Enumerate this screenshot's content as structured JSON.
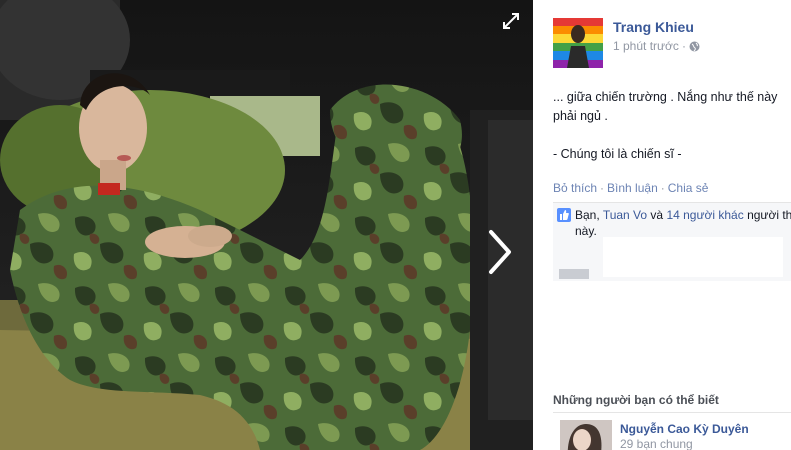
{
  "post": {
    "author": "Trang Khieu",
    "time": "1 phút trước",
    "separator": "·",
    "caption_line1": "... giữa chiến trường . Nắng như thế này",
    "caption_line2": "phải ngủ .",
    "caption_line3": "- Chúng tôi là chiến sĩ -"
  },
  "actions": {
    "like": "Bỏ thích",
    "comment": "Bình luận",
    "share": "Chia sẻ",
    "dot": "·"
  },
  "likes": {
    "you": "Bạn,",
    "friend": "Tuan Vo",
    "and": "và",
    "others": "14 người khác",
    "suffix": "người th",
    "line2": "này."
  },
  "pymk": {
    "title": "Những người bạn có thể biết",
    "name": "Nguyễn Cao Kỳ Duyên",
    "mutual": "29 bạn chung"
  },
  "icons": {
    "expand": "expand-icon",
    "next": "chevron-right-icon",
    "privacy": "globe-icon",
    "like": "thumbs-up-icon"
  },
  "colors": {
    "link": "#3b5998",
    "action": "#6d84b4",
    "muted": "#9197a3",
    "viewer_bg": "#000000"
  }
}
